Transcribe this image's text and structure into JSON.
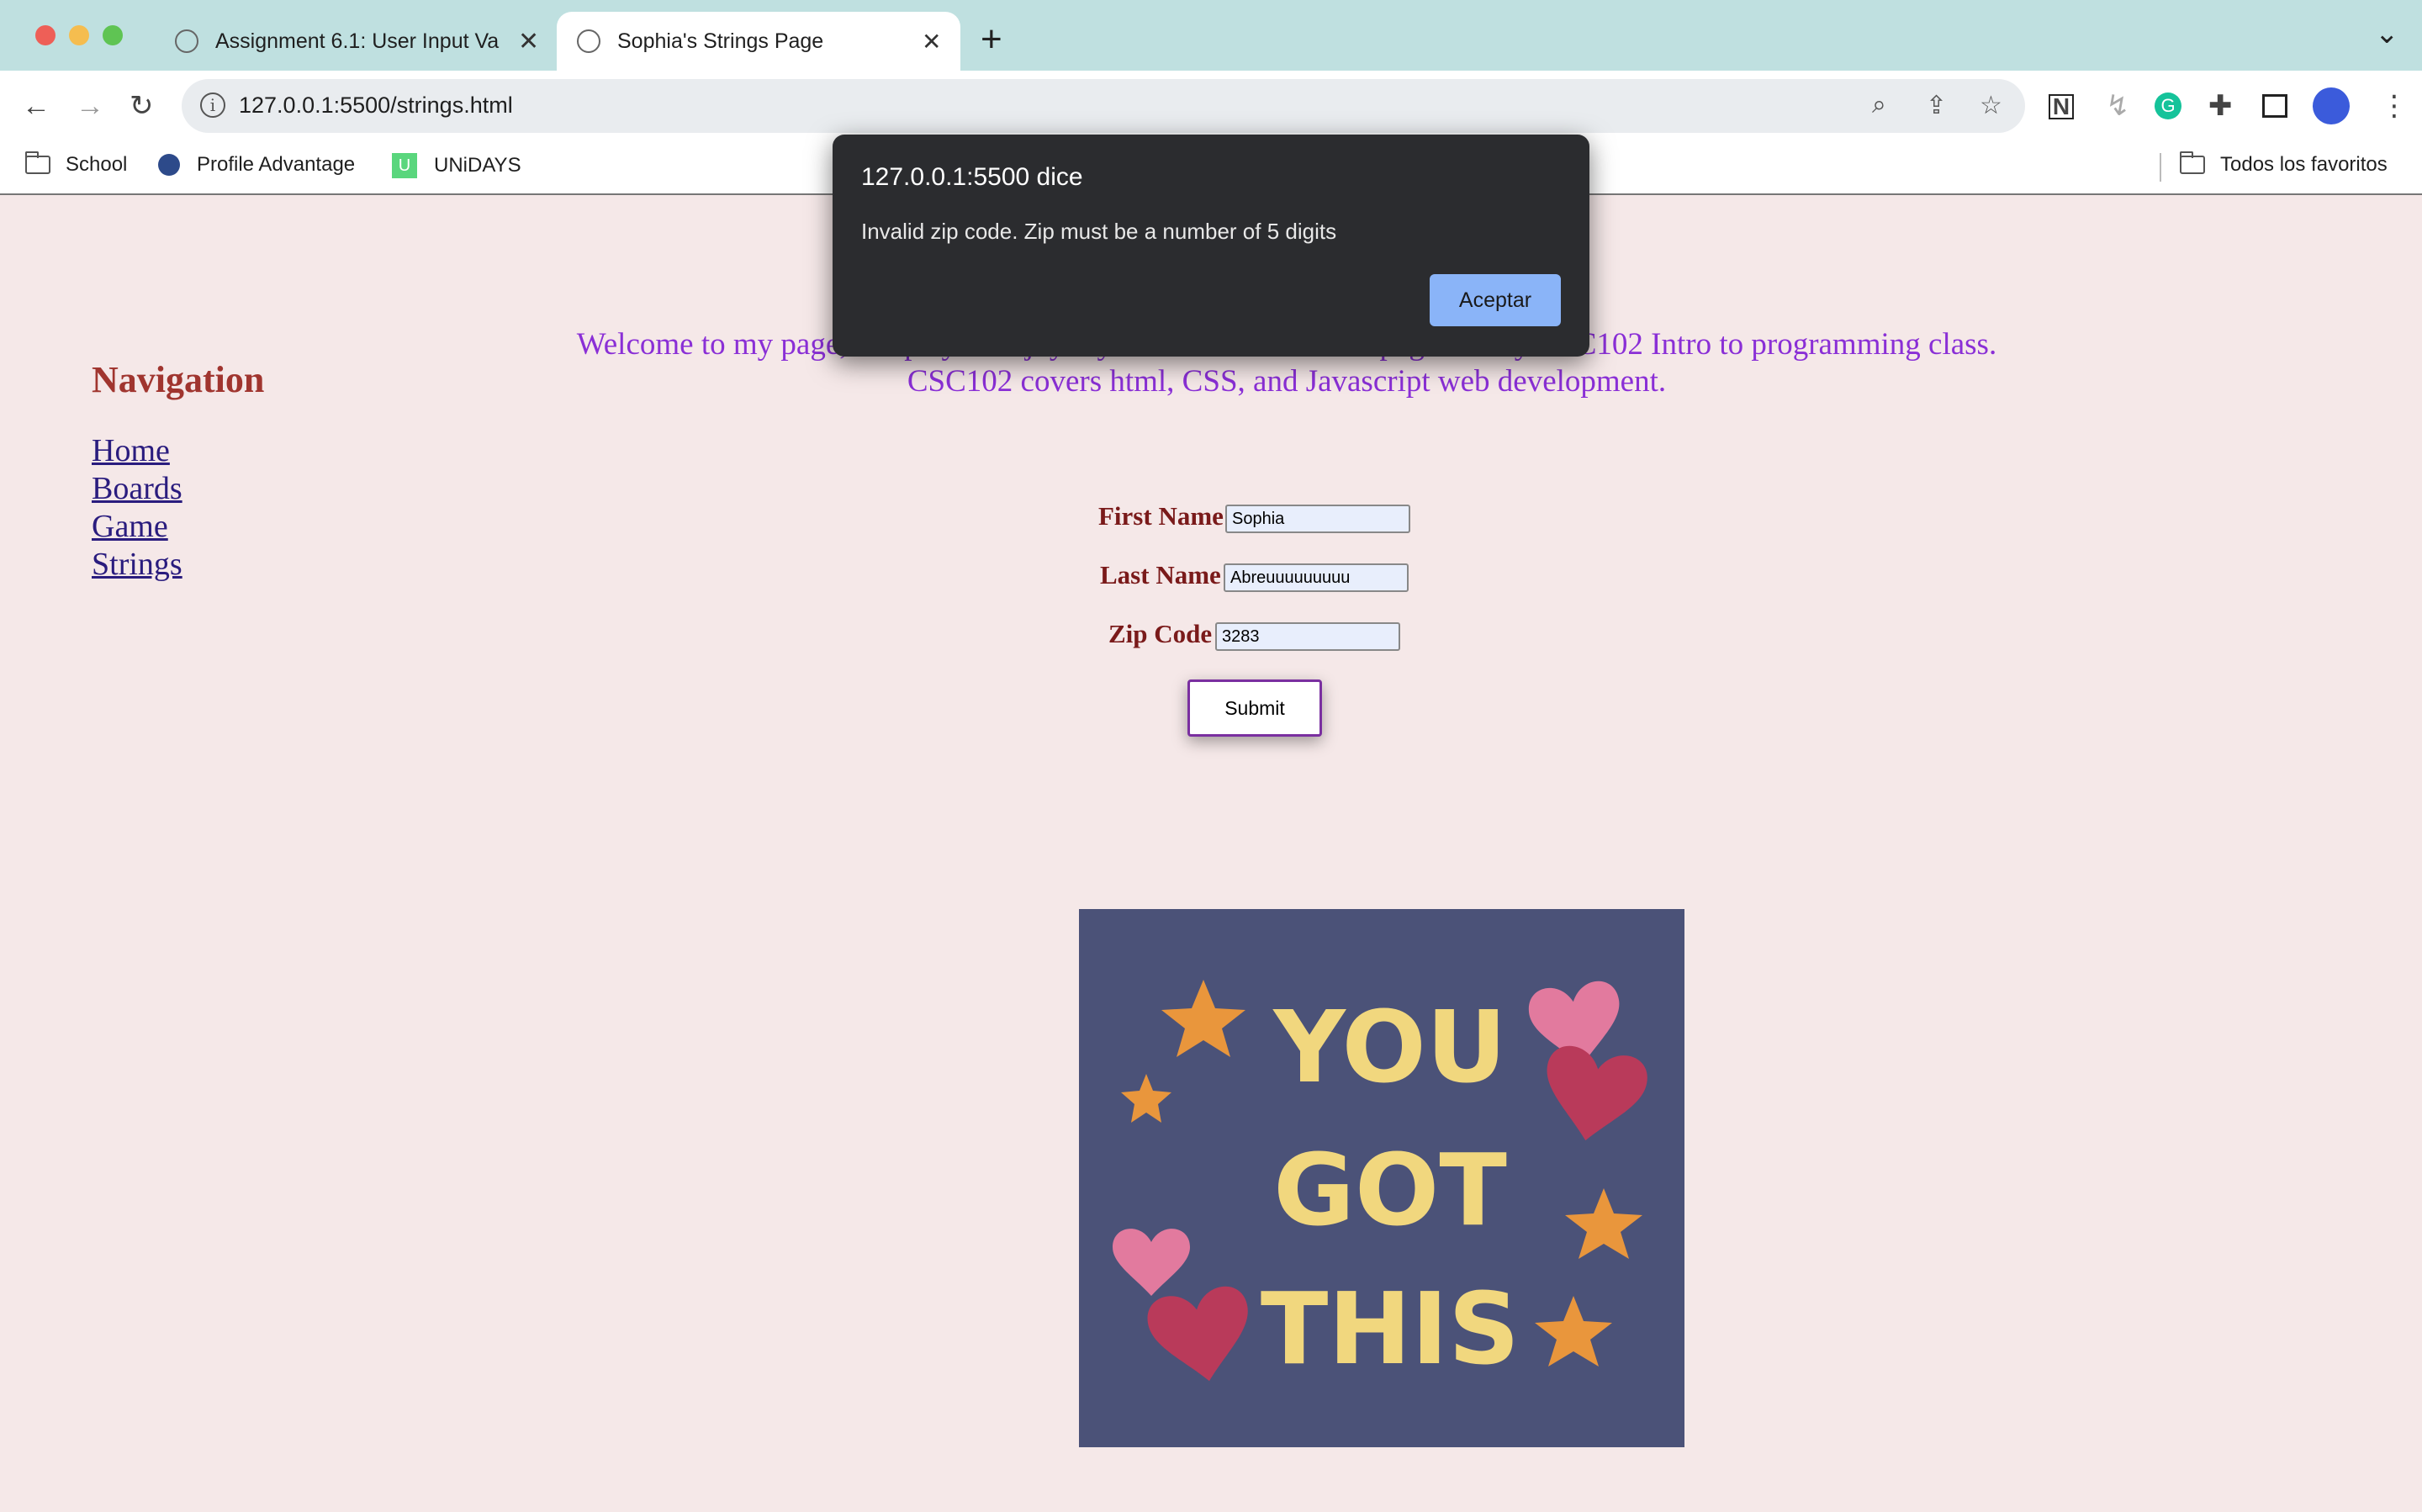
{
  "browser": {
    "tabs": [
      {
        "title": "Assignment 6.1: User Input Va",
        "active": false
      },
      {
        "title": "Sophia's Strings Page",
        "active": true
      }
    ],
    "new_tab": "+",
    "tab_list": "⌄",
    "address_bar": {
      "url": "127.0.0.1:5500/strings.html"
    },
    "bookmarks": [
      {
        "label": "School",
        "icon": "folder-icon"
      },
      {
        "label": "Profile Advantage",
        "icon": "globe-icon"
      },
      {
        "label": "UNiDAYS",
        "icon": "unidays-icon"
      }
    ],
    "all_bookmarks": "Todos los favoritos",
    "colors": {
      "tab_strip": "#bfe0e0",
      "dialog_bg": "#2b2c2f",
      "dialog_button": "#8ab4f8"
    }
  },
  "page": {
    "navigation": {
      "heading": "Navigation",
      "links": [
        "Home",
        "Boards",
        "Game",
        "Strings"
      ]
    },
    "welcome": {
      "line1": "Welcome to my page, I hope you enjoy my website! I made this page for my CSC102 Intro to programming class.",
      "line2": "CSC102 covers html, CSS, and Javascript web development."
    },
    "form": {
      "first_name_label": "First Name",
      "first_name_value": "Sophia",
      "last_name_label": "Last Name",
      "last_name_value": "Abreuuuuuuuuu",
      "zip_label": "Zip Code",
      "zip_value": "3283",
      "submit_label": "Submit"
    },
    "poster": {
      "lines": [
        "YOU",
        "GOT",
        "THIS"
      ],
      "bg": "#4b5278",
      "text_color": "#f1d77e"
    },
    "colors": {
      "background": "#f5e8e8",
      "nav_heading": "#a0352f",
      "welcome_text": "#8a2fd6",
      "form_label": "#7a1a1a"
    }
  },
  "dialog": {
    "title": "127.0.0.1:5500 dice",
    "message": "Invalid zip code. Zip must be a number of 5 digits",
    "ok_label": "Aceptar"
  }
}
